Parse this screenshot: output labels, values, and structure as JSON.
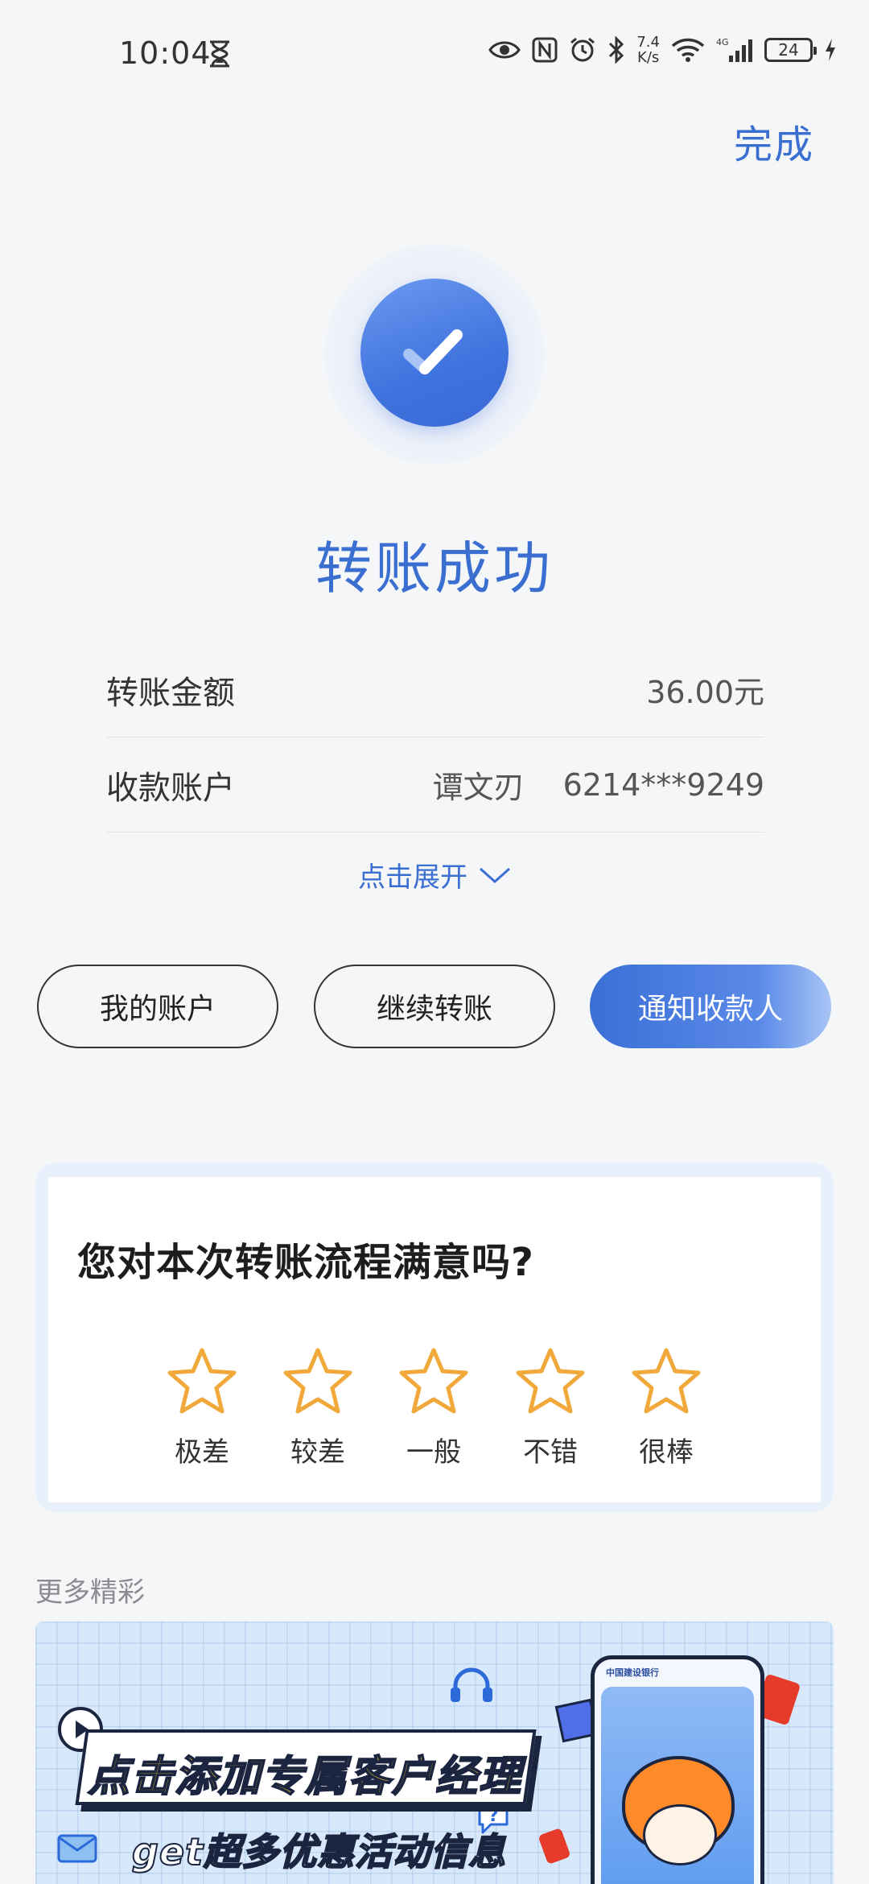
{
  "status_bar": {
    "time": "10:04",
    "net_speed_value": "7.4",
    "net_speed_unit": "K/s",
    "network_type": "4G",
    "battery": "24"
  },
  "header": {
    "done_label": "完成"
  },
  "result": {
    "title": "转账成功"
  },
  "details": {
    "amount_label": "转账金额",
    "amount_value": "36.00元",
    "payee_label": "收款账户",
    "payee_name": "谭文刃",
    "payee_account": "6214***9249"
  },
  "expand": {
    "label": "点击展开"
  },
  "actions": {
    "my_account": "我的账户",
    "continue_transfer": "继续转账",
    "notify_payee": "通知收款人"
  },
  "survey": {
    "question": "您对本次转账流程满意吗?",
    "ratings": [
      "极差",
      "较差",
      "一般",
      "不错",
      "很棒"
    ]
  },
  "more": {
    "title": "更多精彩",
    "banner_headline": "点击添加专属客户经理",
    "banner_subline": "get超多优惠活动信息",
    "phone_brand": "中国建设银行"
  },
  "colors": {
    "accent": "#3a6fd1",
    "star": "#f0a93a",
    "background": "#f5f6f8"
  }
}
